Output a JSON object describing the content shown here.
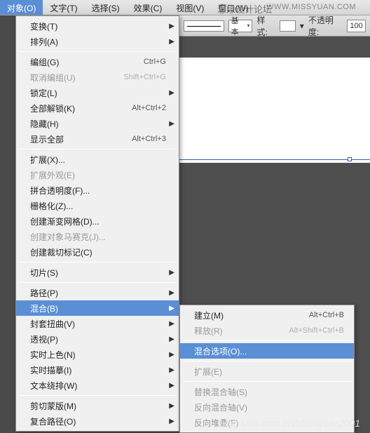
{
  "menubar": {
    "items": [
      "对象(O)",
      "文字(T)",
      "选择(S)",
      "效果(C)",
      "视图(V)",
      "窗口(W)"
    ]
  },
  "header_text": "思缘设计论坛",
  "watermark_top": "WWW.MISSYUAN.COM",
  "watermark_bottom": "blog.sina.com.cn/blueapple2001",
  "toolbar": {
    "basic_label": "基本",
    "style_label": "样式:",
    "opacity_label": "不透明度:",
    "opacity_value": "100"
  },
  "menu": [
    {
      "label": "变换(T)",
      "sub": true
    },
    {
      "label": "排列(A)",
      "sub": true
    },
    {
      "sep": true
    },
    {
      "label": "编组(G)",
      "shortcut": "Ctrl+G"
    },
    {
      "label": "取消编组(U)",
      "shortcut": "Shift+Ctrl+G",
      "disabled": true
    },
    {
      "label": "锁定(L)",
      "sub": true
    },
    {
      "label": "全部解锁(K)",
      "shortcut": "Alt+Ctrl+2"
    },
    {
      "label": "隐藏(H)",
      "sub": true
    },
    {
      "label": "显示全部",
      "shortcut": "Alt+Ctrl+3"
    },
    {
      "sep": true
    },
    {
      "label": "扩展(X)..."
    },
    {
      "label": "扩展外观(E)",
      "disabled": true
    },
    {
      "label": "拼合透明度(F)..."
    },
    {
      "label": "栅格化(Z)..."
    },
    {
      "label": "创建渐变网格(D)..."
    },
    {
      "label": "创建对象马赛克(J)...",
      "disabled": true
    },
    {
      "label": "创建裁切标记(C)"
    },
    {
      "sep": true
    },
    {
      "label": "切片(S)",
      "sub": true
    },
    {
      "sep": true
    },
    {
      "label": "路径(P)",
      "sub": true
    },
    {
      "label": "混合(B)",
      "sub": true,
      "hl": true
    },
    {
      "label": "封套扭曲(V)",
      "sub": true
    },
    {
      "label": "透视(P)",
      "sub": true
    },
    {
      "label": "实时上色(N)",
      "sub": true
    },
    {
      "label": "实时描摹(I)",
      "sub": true
    },
    {
      "label": "文本绕排(W)",
      "sub": true
    },
    {
      "sep": true
    },
    {
      "label": "剪切蒙版(M)",
      "sub": true
    },
    {
      "label": "复合路径(O)",
      "sub": true
    }
  ],
  "submenu": [
    {
      "label": "建立(M)",
      "shortcut": "Alt+Ctrl+B"
    },
    {
      "label": "释放(R)",
      "shortcut": "Alt+Shift+Ctrl+B",
      "disabled": true
    },
    {
      "sep": true
    },
    {
      "label": "混合选项(O)...",
      "hover": true
    },
    {
      "sep": true
    },
    {
      "label": "扩展(E)",
      "disabled": true
    },
    {
      "sep": true
    },
    {
      "label": "替换混合轴(S)",
      "disabled": true
    },
    {
      "label": "反向混合轴(V)",
      "disabled": true
    },
    {
      "label": "反向堆叠(F)",
      "disabled": true
    }
  ]
}
